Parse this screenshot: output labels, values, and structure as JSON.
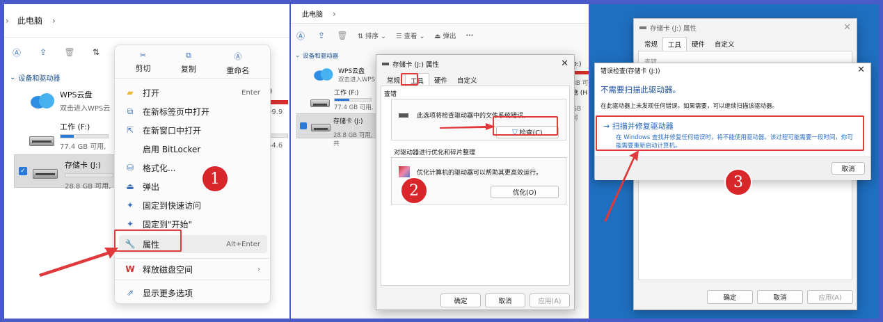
{
  "panel1": {
    "breadcrumb": "此电脑",
    "section": "设备和驱动器",
    "drives": [
      {
        "name": "WPS云盘",
        "sub": "双击进入WPS云"
      },
      {
        "name": "工作 (F:)",
        "sub": "77.4 GB 可用,",
        "fill": 0.22
      },
      {
        "name": "存储卡 (J:)",
        "sub": "28.8 GB 可用,",
        "fill": 0.0
      }
    ],
    "right_frags": [
      ":)",
      "99.9",
      "64.6"
    ],
    "menu": {
      "top": [
        {
          "label": "剪切"
        },
        {
          "label": "复制"
        },
        {
          "label": "重命名"
        }
      ],
      "items": [
        {
          "label": "打开",
          "shortcut": "Enter",
          "icon": "folder-icon"
        },
        {
          "label": "在新标签页中打开",
          "shortcut": "",
          "icon": "new-tab-icon"
        },
        {
          "label": "在新窗口中打开",
          "shortcut": "",
          "icon": "new-window-icon"
        },
        {
          "label": "启用 BitLocker",
          "shortcut": "",
          "icon": ""
        },
        {
          "label": "格式化...",
          "shortcut": "",
          "icon": "format-icon"
        },
        {
          "label": "弹出",
          "shortcut": "",
          "icon": "eject-icon"
        },
        {
          "label": "固定到快速访问",
          "shortcut": "",
          "icon": "pin-icon"
        },
        {
          "label": "固定到\"开始\"",
          "shortcut": "",
          "icon": "pin-icon"
        },
        {
          "label": "属性",
          "shortcut": "Alt+Enter",
          "icon": "wrench-icon"
        },
        {
          "label": "释放磁盘空间",
          "shortcut": "",
          "icon": "wps-icon"
        },
        {
          "label": "显示更多选项",
          "shortcut": "",
          "icon": "more-options-icon"
        }
      ]
    },
    "step": "1"
  },
  "panel2": {
    "breadcrumb": "此电脑",
    "toolbar": {
      "sort": "排序",
      "view": "查看",
      "eject": "弹出"
    },
    "section": "设备和驱动器",
    "drives": [
      {
        "name": "WPS云盘",
        "sub": "双击进入WPS云盘"
      },
      {
        "name": "工作 (F:)",
        "sub": "77.4 GB 可用, 共"
      },
      {
        "name": "存储卡 (J:)",
        "sub": "28.8 GB 可用, 共"
      }
    ],
    "right_frags": [
      "D:)",
      "8B 可",
      "盘 (H",
      "GB 可"
    ],
    "dialog": {
      "title": "存储卡 (J:) 属性",
      "tabs": [
        "常规",
        "工具",
        "硬件",
        "自定义"
      ],
      "g1_title": "查错",
      "g1_text": "此选项将检查驱动器中的文件系统错误。",
      "check_btn": "检查(C)",
      "g2_title": "对驱动器进行优化和碎片整理",
      "g2_text": "优化计算机的驱动器可以帮助其更高效运行。",
      "optimize_btn": "优化(O)",
      "ok": "确定",
      "cancel": "取消",
      "apply": "应用(A)"
    },
    "step": "2"
  },
  "panel3": {
    "bg_dialog": {
      "title": "存储卡 (J:) 属性",
      "tabs": [
        "常规",
        "工具",
        "硬件",
        "自定义"
      ],
      "frag": "查错"
    },
    "err": {
      "title": "错误检查(存储卡 (J:))",
      "heading": "不需要扫描此驱动器。",
      "text": "在此驱动器上未发现任何错误。如果需要，可以继续扫描该驱动器。",
      "link": "→ 扫描并修复驱动器",
      "link_desc1": "在 Windows 查找并修复任何错误时，将不能使用驱动器。该过程可能需要一段时间，你可",
      "link_desc2": "能需要重新启动计算机。",
      "cancel": "取消"
    },
    "ok": "确定",
    "cancel": "取消",
    "apply": "应用(A)",
    "step": "3"
  },
  "colors": {
    "accent": "#2b79d6",
    "red": "#e0393b",
    "frame": "#4a5ac8",
    "desktop": "#1f6fc0"
  }
}
